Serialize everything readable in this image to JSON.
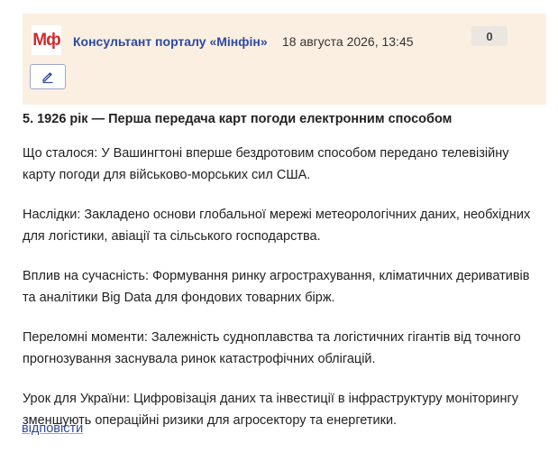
{
  "header": {
    "logo_text": "Мф",
    "author": "Консультант порталу «Мінфін»",
    "date": "18 августа 2026, 13:45",
    "counter": "0",
    "edit_icon": "pencil-icon",
    "background_color": "#fbefe2"
  },
  "post": {
    "title": "5. 1926 рік — Перша передача карт погоди електронним способом",
    "paragraphs": [
      "Що сталося: У Вашингтоні вперше бездротовим способом передано телевізійну карту погоди для військово-морських сил США.",
      "Наслідки: Закладено основи глобальної мережі метеорологічних даних, необхідних для логістики, авіації та сільського господарства.",
      "Вплив на сучасність: Формування ринку агрострахування, кліматичних деривативів та аналітики Big Data для фондових товарних бірж.",
      "Переломні моменти: Залежність судноплавства та логістичних гігантів від точного прогнозування заснувала ринок катастрофічних облігацій.",
      "Урок для України: Цифровізація даних та інвестиції в інфраструктуру моніторингу зменшують операційні ризики для агросектору та енергетики."
    ]
  },
  "actions": {
    "reply_label": "відповісти",
    "link_color": "#2b4aa0"
  }
}
